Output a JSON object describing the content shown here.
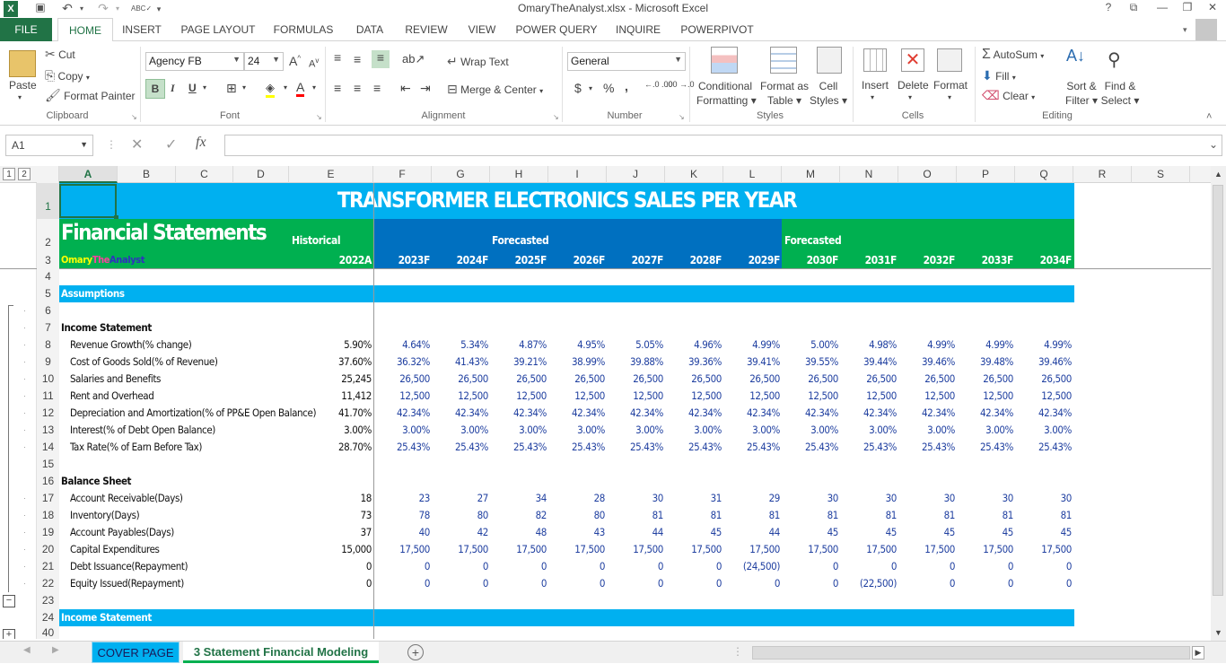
{
  "window": {
    "title": "OmaryTheAnalyst.xlsx - Microsoft Excel",
    "help": "?",
    "restore_ribbon": "⧉",
    "min": "—",
    "max": "❐",
    "close": "✕"
  },
  "qat": {
    "logo": "X",
    "save": "💾",
    "undo": "↶",
    "redo": "↷",
    "spell": "ABC✓",
    "more": "▾"
  },
  "tabs": [
    "FILE",
    "HOME",
    "INSERT",
    "PAGE LAYOUT",
    "FORMULAS",
    "DATA",
    "REVIEW",
    "VIEW",
    "POWER QUERY",
    "INQUIRE",
    "POWERPIVOT"
  ],
  "ribbon": {
    "clipboard": {
      "paste": "Paste",
      "cut": "Cut",
      "copy": "Copy",
      "format_painter": "Format Painter",
      "label": "Clipboard"
    },
    "font": {
      "name": "Agency FB",
      "size": "24",
      "bold": "B",
      "italic": "I",
      "underline": "U",
      "grow": "A",
      "shrink": "A",
      "color_a": "A",
      "label": "Font"
    },
    "alignment": {
      "wrap": "Wrap Text",
      "merge": "Merge & Center",
      "label": "Alignment"
    },
    "number": {
      "format": "General",
      "currency": "$",
      "percent": "%",
      "comma": ",",
      "inc": "←.0 .00",
      "dec": ".00 →.0",
      "label": "Number"
    },
    "styles": {
      "cond1": "Conditional",
      "cond2": "Formatting",
      "table1": "Format as",
      "table2": "Table",
      "cell1": "Cell",
      "cell2": "Styles",
      "label": "Styles"
    },
    "cells": {
      "insert": "Insert",
      "delete": "Delete",
      "format": "Format",
      "label": "Cells"
    },
    "editing": {
      "autosum": "AutoSum",
      "fill": "Fill",
      "clear": "Clear",
      "sort1": "Sort &",
      "sort2": "Filter",
      "find1": "Find &",
      "find2": "Select",
      "label": "Editing"
    }
  },
  "formula_bar": {
    "name_box": "A1",
    "fx": "fx",
    "cancel": "✕",
    "enter": "✓",
    "value": ""
  },
  "outline_levels": [
    "1",
    "2"
  ],
  "columns": [
    "A",
    "B",
    "C",
    "D",
    "E",
    "F",
    "G",
    "H",
    "I",
    "J",
    "K",
    "L",
    "M",
    "N",
    "O",
    "P",
    "Q",
    "R",
    "S"
  ],
  "row_numbers": [
    "1",
    "2",
    "3",
    "4",
    "5",
    "6",
    "7",
    "8",
    "9",
    "10",
    "11",
    "12",
    "13",
    "14",
    "15",
    "16",
    "17",
    "18",
    "19",
    "20",
    "21",
    "22",
    "23",
    "24",
    "40"
  ],
  "sheet": {
    "title": "TRANSFORMER ELECTRONICS SALES PER YEAR",
    "heading": "Financial Statements",
    "brand_a": "Omary",
    "brand_b": "The",
    "brand_c": "Analyst",
    "historical": "Historical",
    "forecasted_1": "Forecasted",
    "forecasted_2": "Forecasted",
    "years": [
      "2022A",
      "2023F",
      "2024F",
      "2025F",
      "2026F",
      "2027F",
      "2028F",
      "2029F",
      "2030F",
      "2031F",
      "2032F",
      "2033F",
      "2034F"
    ],
    "assumptions": "Assumptions",
    "income_statement": "Income Statement",
    "balance_sheet": "Balance Sheet",
    "income_statement_2": "Income Statement",
    "rows": [
      {
        "label": "Revenue Growth(% change)",
        "values": [
          "5.90%",
          "4.64%",
          "5.34%",
          "4.87%",
          "4.95%",
          "5.05%",
          "4.96%",
          "4.99%",
          "5.00%",
          "4.98%",
          "4.99%",
          "4.99%",
          "4.99%"
        ]
      },
      {
        "label": "Cost of Goods Sold(% of Revenue)",
        "values": [
          "37.60%",
          "36.32%",
          "41.43%",
          "39.21%",
          "38.99%",
          "39.88%",
          "39.36%",
          "39.41%",
          "39.55%",
          "39.44%",
          "39.46%",
          "39.48%",
          "39.46%"
        ]
      },
      {
        "label": "Salaries and Benefits",
        "values": [
          "25,245",
          "26,500",
          "26,500",
          "26,500",
          "26,500",
          "26,500",
          "26,500",
          "26,500",
          "26,500",
          "26,500",
          "26,500",
          "26,500",
          "26,500"
        ]
      },
      {
        "label": "Rent and Overhead",
        "values": [
          "11,412",
          "12,500",
          "12,500",
          "12,500",
          "12,500",
          "12,500",
          "12,500",
          "12,500",
          "12,500",
          "12,500",
          "12,500",
          "12,500",
          "12,500"
        ]
      },
      {
        "label": "Depreciation and Amortization(% of PP&E Open Balance)",
        "values": [
          "41.70%",
          "42.34%",
          "42.34%",
          "42.34%",
          "42.34%",
          "42.34%",
          "42.34%",
          "42.34%",
          "42.34%",
          "42.34%",
          "42.34%",
          "42.34%",
          "42.34%"
        ]
      },
      {
        "label": "Interest(% of Debt Open Balance)",
        "values": [
          "3.00%",
          "3.00%",
          "3.00%",
          "3.00%",
          "3.00%",
          "3.00%",
          "3.00%",
          "3.00%",
          "3.00%",
          "3.00%",
          "3.00%",
          "3.00%",
          "3.00%"
        ]
      },
      {
        "label": "Tax Rate(% of Earn Before Tax)",
        "values": [
          "28.70%",
          "25.43%",
          "25.43%",
          "25.43%",
          "25.43%",
          "25.43%",
          "25.43%",
          "25.43%",
          "25.43%",
          "25.43%",
          "25.43%",
          "25.43%",
          "25.43%"
        ]
      }
    ],
    "bs_rows": [
      {
        "label": "Account Receivable(Days)",
        "values": [
          "18",
          "23",
          "27",
          "34",
          "28",
          "30",
          "31",
          "29",
          "30",
          "30",
          "30",
          "30",
          "30"
        ]
      },
      {
        "label": "Inventory(Days)",
        "values": [
          "73",
          "78",
          "80",
          "82",
          "80",
          "81",
          "81",
          "81",
          "81",
          "81",
          "81",
          "81",
          "81"
        ]
      },
      {
        "label": "Account Payables(Days)",
        "values": [
          "37",
          "40",
          "42",
          "48",
          "43",
          "44",
          "45",
          "44",
          "45",
          "45",
          "45",
          "45",
          "45"
        ]
      },
      {
        "label": "Capital Expenditures",
        "values": [
          "15,000",
          "17,500",
          "17,500",
          "17,500",
          "17,500",
          "17,500",
          "17,500",
          "17,500",
          "17,500",
          "17,500",
          "17,500",
          "17,500",
          "17,500"
        ]
      },
      {
        "label": "Debt Issuance(Repayment)",
        "values": [
          "0",
          "0",
          "0",
          "0",
          "0",
          "0",
          "0",
          "(24,500)",
          "0",
          "0",
          "0",
          "0",
          "0"
        ]
      },
      {
        "label": "Equity Issued(Repayment)",
        "values": [
          "0",
          "0",
          "0",
          "0",
          "0",
          "0",
          "0",
          "0",
          "0",
          "(22,500)",
          "0",
          "0",
          "0"
        ]
      }
    ]
  },
  "sheet_tabs": {
    "cover": "COVER PAGE",
    "active": "3 Statement Financial Modeling",
    "add": "+"
  },
  "colors": {
    "excel_green": "#217346",
    "title_blue": "#00b0f0",
    "header_green": "#00b050",
    "forecast_blue": "#0070c0"
  }
}
